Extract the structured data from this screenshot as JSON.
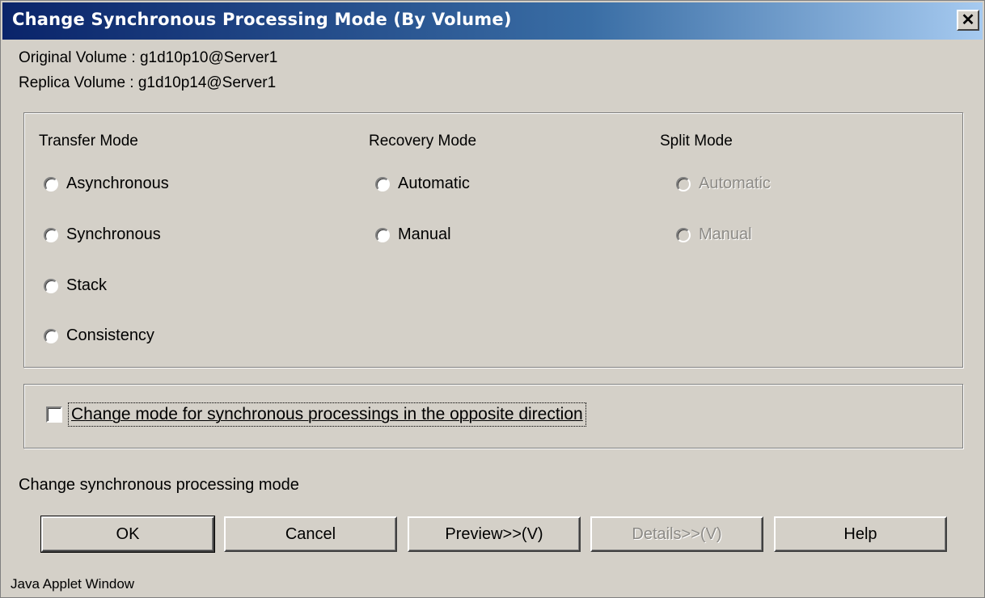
{
  "window": {
    "title": "Change Synchronous Processing Mode (By Volume)",
    "close_glyph": "✕"
  },
  "info": {
    "original": "Original Volume : g1d10p10@Server1",
    "replica": "Replica Volume : g1d10p14@Server1"
  },
  "transfer": {
    "header": "Transfer Mode",
    "options": [
      "Asynchronous",
      "Synchronous",
      "Stack",
      "Consistency"
    ]
  },
  "recovery": {
    "header": "Recovery Mode",
    "options": [
      "Automatic",
      "Manual"
    ]
  },
  "split": {
    "header": "Split Mode",
    "options": [
      "Automatic",
      "Manual"
    ],
    "disabled": true
  },
  "opposite": {
    "label": "Change mode for synchronous processings in the opposite direction",
    "checked": false
  },
  "status": "Change synchronous processing mode",
  "buttons": {
    "ok": "OK",
    "cancel": "Cancel",
    "preview": "Preview>>(V)",
    "details": "Details>>(V)",
    "help": "Help"
  },
  "footer": "Java Applet Window",
  "colors": {
    "title_start": "#0a246a",
    "title_end": "#a6caf0",
    "face": "#d4d0c8",
    "disabled_text": "#8c8a86"
  }
}
